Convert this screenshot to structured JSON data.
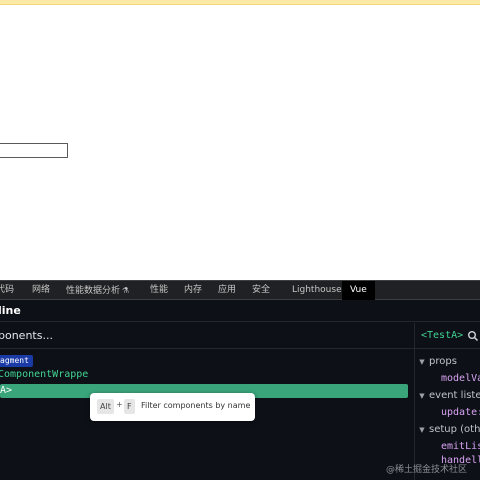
{
  "devtools": {
    "tabs": [
      {
        "label": "代码"
      },
      {
        "label": "网络"
      },
      {
        "label": "性能数据分析"
      },
      {
        "label": "性能"
      },
      {
        "label": "内存"
      },
      {
        "label": "应用"
      },
      {
        "label": "安全"
      },
      {
        "label": "Lighthouse"
      },
      {
        "label": "Vue"
      }
    ],
    "active_tab": "Vue"
  },
  "vue_panel": {
    "header_title": "line",
    "search_placeholder": "ponents...",
    "tree": {
      "fragment_badge": "agment",
      "wrapper_row": "ComponentWrappe",
      "selected_row": "A>"
    },
    "tooltip": {
      "key1": "Alt",
      "plus": "+",
      "key2": "F",
      "text": "Filter components by name"
    }
  },
  "inspector": {
    "component_name": "<TestA>",
    "sections": [
      {
        "label": "props",
        "items": [
          "modelVa"
        ]
      },
      {
        "label": "event liste",
        "items": [
          "update:"
        ]
      },
      {
        "label": "setup (oth",
        "items": [
          "emitLis",
          "handell"
        ]
      }
    ]
  },
  "watermark": "@稀土掘金技术社区",
  "colors": {
    "accent_green": "#42d392",
    "selected_row_bg": "#3aa57a",
    "fragment_badge_bg": "#1a3aa6",
    "panel_bg": "#0d1117"
  }
}
